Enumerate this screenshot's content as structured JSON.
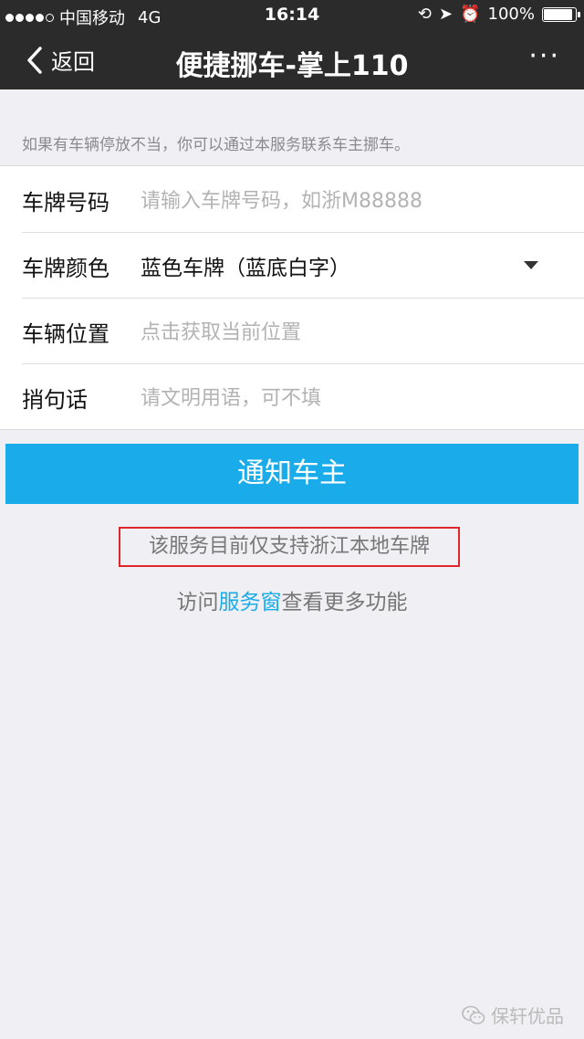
{
  "status_bar": {
    "carrier": "中国移动",
    "network": "4G",
    "time": "16:14",
    "battery": "100%"
  },
  "nav": {
    "back_label": "返回",
    "title": "便捷挪车-掌上110",
    "more_label": "···"
  },
  "intro_text": "如果有车辆停放不当，你可以通过本服务联系车主挪车。",
  "form": {
    "plate_number": {
      "label": "车牌号码",
      "placeholder": "请输入车牌号码，如浙M88888"
    },
    "plate_color": {
      "label": "车牌颜色",
      "value": "蓝色车牌（蓝底白字）"
    },
    "location": {
      "label": "车辆位置",
      "placeholder": "点击获取当前位置"
    },
    "message": {
      "label": "捎句话",
      "placeholder": "请文明用语，可不填"
    }
  },
  "notify_button": "通知车主",
  "notice": "该服务目前仅支持浙江本地车牌",
  "more_link": {
    "prefix": "访问",
    "link": "服务窗",
    "suffix": "查看更多功能"
  },
  "watermark": "保轩优品",
  "colors": {
    "accent": "#1aacea",
    "navbar": "#2b2b2b",
    "notice_border": "#e0262d"
  }
}
